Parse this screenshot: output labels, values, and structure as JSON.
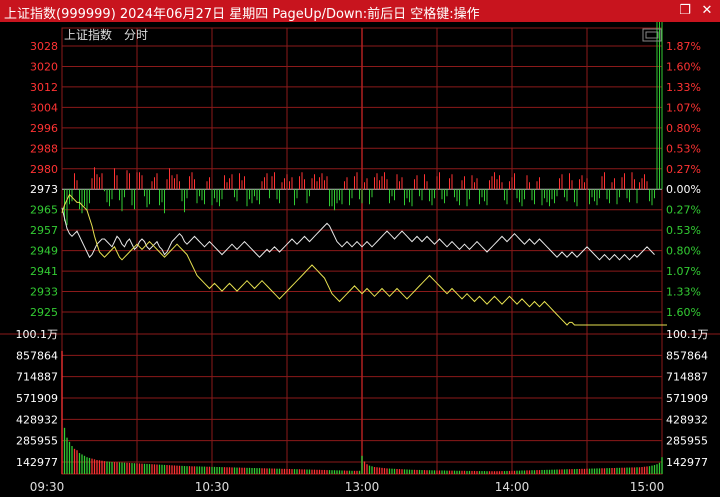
{
  "window": {
    "title": "上证指数(999999) 2024年06月27日 星期四 PageUp/Down:前后日 空格键:操作",
    "restore_icon": "restore-icon",
    "close_icon": "close-icon"
  },
  "chart_header": {
    "index_name": "上证指数",
    "mode": "分时"
  },
  "colors": {
    "up": "#ff3333",
    "down": "#33cc33",
    "flat": "#ffffff",
    "grid": "#8b1a1a",
    "white_line": "#e8e8e8",
    "yellow_line": "#e6e050"
  },
  "chart_data": {
    "type": "line",
    "price_axis": {
      "ticks": [
        "3028",
        "3020",
        "3012",
        "3004",
        "2996",
        "2988",
        "2980",
        "2973",
        "2965",
        "2957",
        "2949",
        "2941",
        "2933",
        "2925"
      ],
      "pct": [
        "1.87%",
        "1.60%",
        "1.33%",
        "1.07%",
        "0.80%",
        "0.53%",
        "0.27%",
        "0.00%",
        "0.27%",
        "0.53%",
        "0.80%",
        "1.07%",
        "1.33%",
        "1.60%"
      ],
      "prev_close": 2973,
      "ylim": [
        2921,
        3028
      ]
    },
    "volume_axis": {
      "unit_label": "100.1万",
      "ticks": [
        "857864",
        "714887",
        "571909",
        "428932",
        "285955",
        "142977"
      ],
      "ylim": [
        0,
        1001000
      ]
    },
    "time_labels": [
      "09:30",
      "10:30",
      "13:00",
      "14:00",
      "15:00"
    ],
    "minutes": 241,
    "series": [
      {
        "key": "white",
        "values": [
          2966,
          2962,
          2958,
          2956,
          2955,
          2956,
          2957,
          2955,
          2953,
          2951,
          2949,
          2947,
          2948,
          2950,
          2952,
          2953,
          2954,
          2954,
          2953,
          2952,
          2951,
          2953,
          2955,
          2954,
          2952,
          2951,
          2953,
          2954,
          2952,
          2950,
          2951,
          2953,
          2954,
          2953,
          2951,
          2950,
          2951,
          2952,
          2953,
          2951,
          2950,
          2948,
          2949,
          2951,
          2953,
          2954,
          2955,
          2956,
          2955,
          2953,
          2952,
          2953,
          2954,
          2955,
          2954,
          2953,
          2952,
          2951,
          2952,
          2953,
          2952,
          2951,
          2950,
          2949,
          2948,
          2949,
          2950,
          2951,
          2952,
          2951,
          2950,
          2951,
          2952,
          2953,
          2952,
          2951,
          2950,
          2949,
          2948,
          2947,
          2948,
          2949,
          2950,
          2949,
          2950,
          2951,
          2950,
          2949,
          2950,
          2951,
          2952,
          2953,
          2954,
          2953,
          2952,
          2953,
          2954,
          2955,
          2954,
          2953,
          2954,
          2955,
          2956,
          2957,
          2958,
          2959,
          2960,
          2959,
          2957,
          2955,
          2953,
          2952,
          2951,
          2952,
          2953,
          2952,
          2951,
          2952,
          2953,
          2952,
          2951,
          2952,
          2953,
          2952,
          2951,
          2952,
          2953,
          2954,
          2955,
          2956,
          2957,
          2956,
          2955,
          2954,
          2955,
          2956,
          2957,
          2956,
          2955,
          2954,
          2953,
          2954,
          2955,
          2954,
          2953,
          2954,
          2955,
          2954,
          2953,
          2952,
          2953,
          2954,
          2953,
          2952,
          2951,
          2952,
          2953,
          2952,
          2951,
          2950,
          2951,
          2952,
          2951,
          2950,
          2951,
          2952,
          2953,
          2952,
          2951,
          2950,
          2949,
          2950,
          2951,
          2952,
          2953,
          2954,
          2955,
          2954,
          2953,
          2954,
          2955,
          2956,
          2955,
          2954,
          2953,
          2952,
          2953,
          2954,
          2953,
          2952,
          2953,
          2954,
          2953,
          2952,
          2951,
          2950,
          2949,
          2948,
          2947,
          2948,
          2949,
          2948,
          2947,
          2948,
          2949,
          2948,
          2947,
          2948,
          2949,
          2950,
          2951,
          2950,
          2949,
          2948,
          2947,
          2946,
          2947,
          2948,
          2947,
          2946,
          2947,
          2948,
          2947,
          2946,
          2947,
          2948,
          2947,
          2946,
          2947,
          2948,
          2947,
          2948,
          2949,
          2950,
          2951,
          2950,
          2949,
          2948
        ]
      },
      {
        "key": "yellow",
        "values": [
          2964,
          2967,
          2969,
          2971,
          2970,
          2969,
          2968,
          2968,
          2967,
          2966,
          2965,
          2962,
          2959,
          2955,
          2952,
          2949,
          2948,
          2947,
          2948,
          2949,
          2950,
          2951,
          2949,
          2947,
          2946,
          2947,
          2948,
          2949,
          2950,
          2951,
          2952,
          2951,
          2950,
          2951,
          2952,
          2953,
          2952,
          2951,
          2950,
          2949,
          2948,
          2947,
          2948,
          2949,
          2950,
          2951,
          2952,
          2951,
          2950,
          2949,
          2948,
          2946,
          2944,
          2942,
          2940,
          2939,
          2938,
          2937,
          2936,
          2935,
          2936,
          2937,
          2936,
          2935,
          2934,
          2935,
          2936,
          2937,
          2936,
          2935,
          2934,
          2935,
          2936,
          2937,
          2938,
          2937,
          2936,
          2935,
          2936,
          2937,
          2938,
          2937,
          2936,
          2935,
          2934,
          2933,
          2932,
          2931,
          2932,
          2933,
          2934,
          2935,
          2936,
          2937,
          2938,
          2939,
          2940,
          2941,
          2942,
          2943,
          2944,
          2943,
          2942,
          2941,
          2940,
          2939,
          2937,
          2935,
          2933,
          2932,
          2931,
          2930,
          2931,
          2932,
          2933,
          2934,
          2935,
          2936,
          2935,
          2934,
          2933,
          2934,
          2935,
          2934,
          2933,
          2932,
          2933,
          2934,
          2935,
          2934,
          2933,
          2932,
          2933,
          2934,
          2935,
          2934,
          2933,
          2932,
          2931,
          2932,
          2933,
          2934,
          2935,
          2936,
          2937,
          2938,
          2939,
          2940,
          2939,
          2938,
          2937,
          2936,
          2935,
          2934,
          2933,
          2934,
          2935,
          2934,
          2933,
          2932,
          2931,
          2932,
          2933,
          2932,
          2931,
          2930,
          2931,
          2932,
          2931,
          2930,
          2929,
          2930,
          2931,
          2932,
          2931,
          2930,
          2929,
          2930,
          2931,
          2932,
          2931,
          2930,
          2929,
          2930,
          2931,
          2930,
          2929,
          2928,
          2929,
          2930,
          2929,
          2928,
          2929,
          2930,
          2929,
          2928,
          2927,
          2926,
          2925,
          2924,
          2923,
          2922,
          2921,
          2922,
          2922,
          2921,
          2921,
          2921,
          2921,
          2921,
          2921,
          2921,
          2921,
          2921,
          2921,
          2921,
          2921,
          2921,
          2921,
          2921,
          2921,
          2921,
          2921,
          2921,
          2921,
          2921,
          2921,
          2921,
          2921,
          2921,
          2921,
          2921,
          2921,
          2921,
          2921,
          2921,
          2921,
          2921,
          2921,
          2921,
          2921,
          2921,
          2921
        ]
      }
    ],
    "volume": [
      880000,
      330000,
      260000,
      230000,
      200000,
      180000,
      170000,
      150000,
      140000,
      130000,
      120000,
      115000,
      110000,
      105000,
      100000,
      98000,
      95000,
      92000,
      90000,
      88000,
      86000,
      85000,
      84000,
      83000,
      82000,
      81000,
      80000,
      79000,
      78000,
      77000,
      76000,
      75000,
      74000,
      73000,
      72000,
      71000,
      70000,
      69000,
      68000,
      67000,
      66000,
      65000,
      64000,
      63000,
      62000,
      61000,
      60000,
      59000,
      58000,
      57000,
      56000,
      56000,
      55000,
      55000,
      54000,
      54000,
      53000,
      53000,
      52000,
      52000,
      51000,
      51000,
      50000,
      50000,
      49000,
      49000,
      48000,
      48000,
      47000,
      47000,
      46000,
      46000,
      45000,
      45000,
      44000,
      44000,
      43000,
      43000,
      42000,
      42000,
      41000,
      41000,
      40000,
      40000,
      39000,
      39000,
      38000,
      38000,
      37000,
      37000,
      36000,
      36000,
      35000,
      35000,
      34000,
      34000,
      33000,
      33000,
      32000,
      32000,
      31000,
      31000,
      30000,
      30000,
      29000,
      29000,
      28000,
      28000,
      27000,
      27000,
      26000,
      26000,
      25000,
      25000,
      24000,
      24000,
      23000,
      23000,
      23000,
      23000,
      130000,
      90000,
      70000,
      60000,
      55000,
      50000,
      48000,
      46000,
      44000,
      42000,
      40000,
      39000,
      38000,
      37000,
      36000,
      35000,
      34000,
      33000,
      32000,
      31000,
      30000,
      30000,
      29000,
      29000,
      28000,
      28000,
      27000,
      27000,
      26000,
      26000,
      25000,
      25000,
      25000,
      25000,
      24000,
      24000,
      24000,
      24000,
      23000,
      23000,
      23000,
      23000,
      22000,
      22000,
      22000,
      22000,
      21000,
      21000,
      21000,
      21000,
      20000,
      20000,
      20000,
      20000,
      20000,
      20000,
      21000,
      21000,
      22000,
      22000,
      23000,
      23000,
      24000,
      24000,
      25000,
      25000,
      26000,
      26000,
      27000,
      27000,
      28000,
      28000,
      29000,
      29000,
      30000,
      30000,
      31000,
      31000,
      32000,
      32000,
      33000,
      33000,
      34000,
      34000,
      35000,
      35000,
      36000,
      36000,
      37000,
      37000,
      38000,
      38000,
      39000,
      39000,
      40000,
      40000,
      41000,
      41000,
      42000,
      42000,
      43000,
      43000,
      44000,
      44000,
      45000,
      45000,
      46000,
      46000,
      47000,
      47000,
      48000,
      48000,
      50000,
      52000,
      54000,
      56000,
      60000,
      64000,
      70000,
      80000,
      120000
    ]
  }
}
